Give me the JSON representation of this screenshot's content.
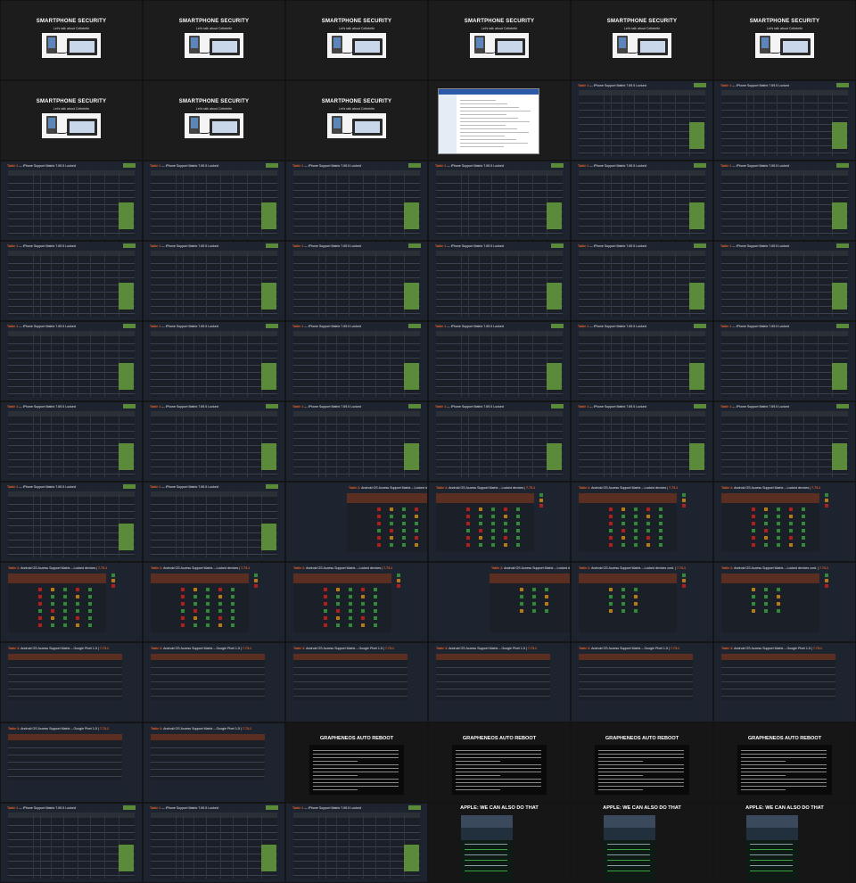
{
  "title_slide": {
    "title": "SMARTPHONE SECURITY",
    "subtitle": "Let's talk about Cellebrite"
  },
  "iphone_table": {
    "label": "Table 1",
    "title": "iPhone Support Matrix 7.69.5 Locked"
  },
  "android_locked": {
    "label": "Table 2",
    "title": "Android OS Access Support Matrix – Locked devices",
    "version": "7.73.1"
  },
  "android_locked_cont": {
    "label": "Table 2",
    "title": "Android OS Access Support Matrix – Locked devices cont.",
    "version": "7.73.1"
  },
  "android_pixel": {
    "label": "Table 3",
    "title": "Android OS Access Support Matrix – Google Pixel 1-5",
    "version": "7.73.1"
  },
  "grapheneos": {
    "title": "GRAPHENEOS AUTO REBOOT"
  },
  "apple": {
    "title": "APPLE: WE CAN ALSO DO THAT"
  },
  "colors": {
    "background": "#141414",
    "accent_orange": "#e5622a",
    "support_green": "#5b8a3a",
    "matrix_red": "#b01e1e",
    "matrix_green": "#2f8a3a",
    "matrix_orange": "#b87a16",
    "header_brown": "#5a2f22"
  },
  "slides": [
    "title",
    "title",
    "title",
    "title",
    "title",
    "title",
    "title",
    "title",
    "title",
    "screenshot",
    "iphone",
    "iphone",
    "iphone",
    "iphone",
    "iphone",
    "iphone",
    "iphone",
    "iphone",
    "iphone",
    "iphone",
    "iphone",
    "iphone",
    "iphone",
    "iphone",
    "iphone",
    "iphone",
    "iphone",
    "iphone",
    "iphone",
    "iphone",
    "iphone",
    "iphone",
    "iphone",
    "iphone",
    "iphone",
    "iphone",
    "iphone",
    "iphone",
    "android_locked_cropped",
    "android_locked",
    "android_locked",
    "android_locked",
    "android_locked",
    "android_locked",
    "android_locked",
    "android_cont_cropped",
    "android_cont",
    "android_cont",
    "pixel",
    "pixel",
    "pixel",
    "pixel",
    "pixel",
    "pixel",
    "pixel",
    "pixel",
    "grapheneos",
    "grapheneos",
    "grapheneos",
    "grapheneos",
    "iphone",
    "iphone",
    "iphone",
    "apple",
    "apple",
    "apple"
  ]
}
